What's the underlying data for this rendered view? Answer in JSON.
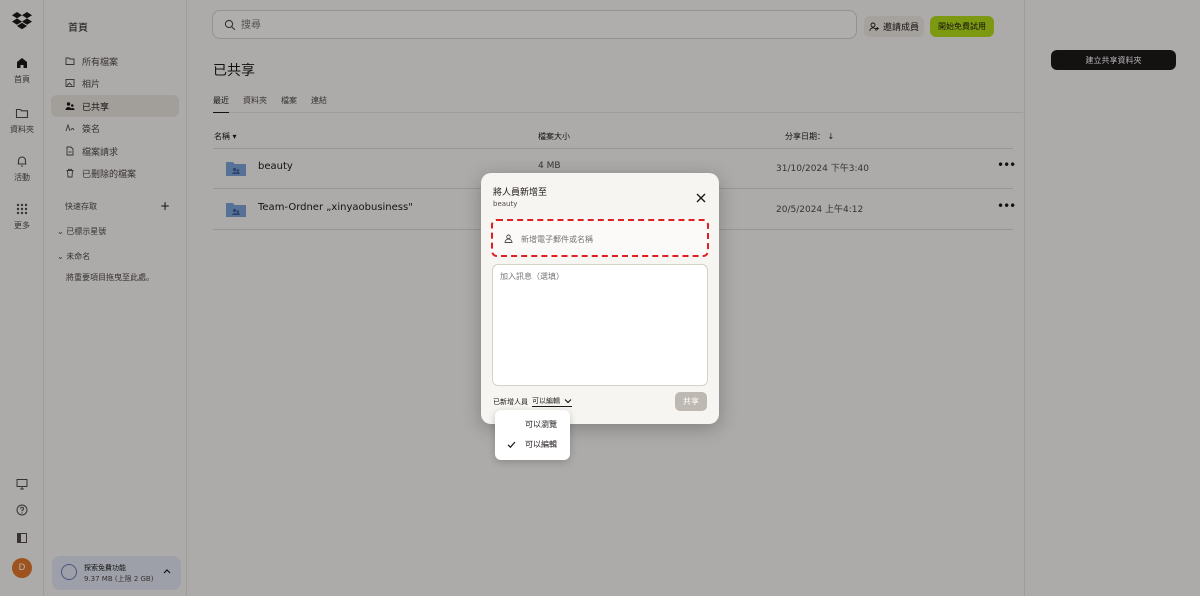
{
  "rail": {
    "items": [
      {
        "label": "首頁"
      },
      {
        "label": "資料夾"
      },
      {
        "label": "活動"
      },
      {
        "label": "更多"
      }
    ],
    "avatar_initial": "D"
  },
  "sidebar": {
    "title": "首頁",
    "items": [
      {
        "label": "所有檔案"
      },
      {
        "label": "相片"
      },
      {
        "label": "已共享"
      },
      {
        "label": "簽名"
      },
      {
        "label": "檔案請求"
      },
      {
        "label": "已刪除的檔案"
      }
    ],
    "quick_access": "快速存取",
    "starred": "已標示星號",
    "untitled": "未命名",
    "drag_hint": "將重要項目拖曳至此處。",
    "storage": {
      "title": "探索免費功能",
      "usage": "9.37 MB (上限 2 GB)"
    }
  },
  "topbar": {
    "search_placeholder": "搜尋",
    "invite_label": "邀請成員",
    "trial_label": "開始免費試用"
  },
  "main": {
    "title": "已共享",
    "tabs": [
      "最近",
      "資料夾",
      "檔案",
      "連結"
    ],
    "columns": {
      "name": "名稱 ▾",
      "size": "檔案大小",
      "date": "分享日期： ↓"
    },
    "rows": [
      {
        "name": "beauty",
        "size": "4 MB",
        "date": "31/10/2024 下午3:40"
      },
      {
        "name": "Team-Ordner „xinyaobusiness\"",
        "size": "",
        "date": "20/5/2024 上午4:12"
      }
    ]
  },
  "right_panel": {
    "create_label": "建立共享資料夾"
  },
  "modal": {
    "title": "將人員新增至",
    "subtitle": "beauty",
    "email_placeholder": "新增電子郵件或名稱",
    "message_placeholder": "加入訊息（選填）",
    "perm_label": "已新增人員",
    "perm_value": "可以編輯",
    "share_label": "共享"
  },
  "dropdown": {
    "options": [
      "可以瀏覽",
      "可以編輯"
    ],
    "selected": "可以編輯"
  }
}
